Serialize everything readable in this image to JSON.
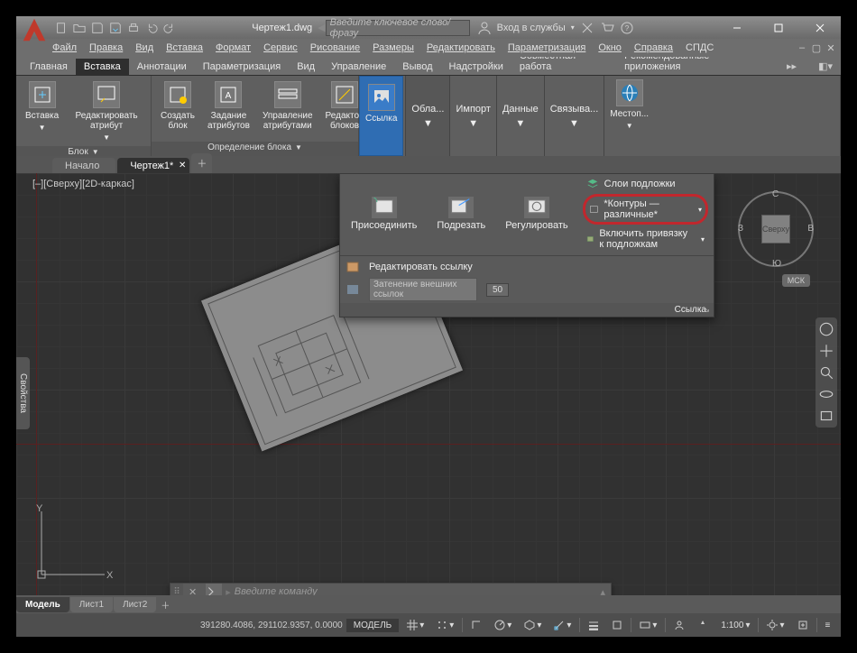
{
  "title": "Чертеж1.dwg",
  "search_placeholder": "Введите ключевое слово/фразу",
  "signin": "Вход в службы",
  "menu": [
    "Файл",
    "Правка",
    "Вид",
    "Вставка",
    "Формат",
    "Сервис",
    "Рисование",
    "Размеры",
    "Редактировать",
    "Параметризация",
    "Окно",
    "Справка",
    "СПДС"
  ],
  "ribtabs": [
    "Главная",
    "Вставка",
    "Аннотации",
    "Параметризация",
    "Вид",
    "Управление",
    "Вывод",
    "Надстройки",
    "Совместная работа",
    "Рекомендованные приложения"
  ],
  "ribtab_active": 1,
  "panels": {
    "blok": {
      "title": "Блок",
      "items": [
        "Вставка",
        "Редактировать атрибут"
      ]
    },
    "blokdef": {
      "title": "Определение блока",
      "items": [
        "Создать блок",
        "Задание атрибутов",
        "Управление атрибутами",
        "Редактор блоков"
      ]
    },
    "ssylka": {
      "title": "Ссылка",
      "big": "Ссылка",
      "tabs": [
        "Обла...",
        "Импорт",
        "Данные",
        "Связыва..."
      ],
      "last": "Местоп..."
    }
  },
  "doctabs": {
    "items": [
      "Начало",
      "Чертеж1*"
    ],
    "active": 1
  },
  "vs_label": "[–][Сверху][2D-каркас]",
  "props_tab": "Свойства",
  "dropdown": {
    "row1": [
      "Присоединить",
      "Подрезать",
      "Регулировать"
    ],
    "right": [
      "Слои подложки",
      "*Контуры — различные*",
      "Включить привязку к подложкам"
    ],
    "edit": "Редактировать ссылку",
    "fade_label": "Затенение внешних ссылок",
    "fade_value": "50",
    "footer": "Ссылка"
  },
  "viewcube": {
    "face": "Сверху",
    "n": "С",
    "s": "Ю",
    "e": "В",
    "w": "З",
    "wcs": "МСК"
  },
  "cmd_placeholder": "Введите команду",
  "layout_tabs": [
    "Модель",
    "Лист1",
    "Лист2"
  ],
  "status": {
    "coords": "391280.4086, 291102.9357, 0.0000",
    "model": "МОДЕЛЬ",
    "scale": "1:100"
  },
  "ucs": {
    "x": "X",
    "y": "Y"
  }
}
